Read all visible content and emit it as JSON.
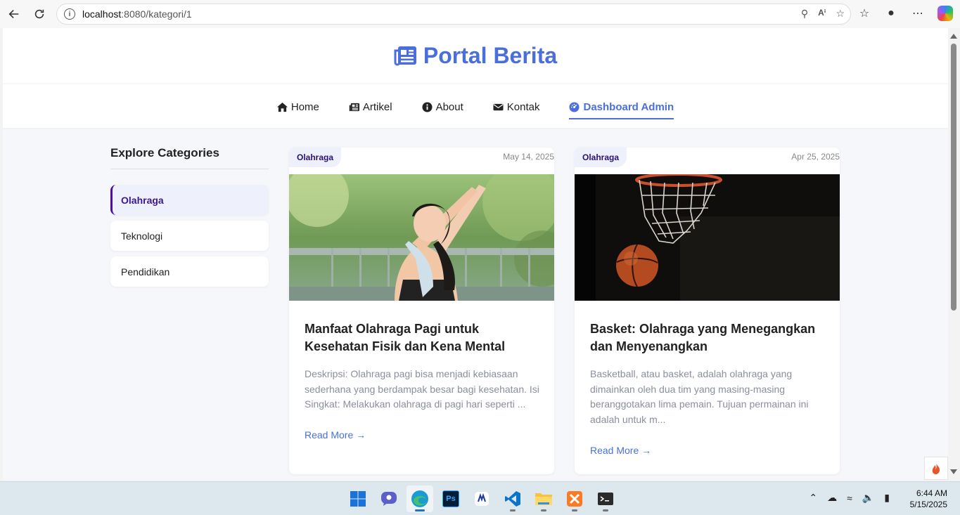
{
  "browser": {
    "url_host": "localhost",
    "url_path": ":8080/kategori/1"
  },
  "site": {
    "brand": "Portal Berita",
    "nav": [
      {
        "label": "Home",
        "icon": "home-icon"
      },
      {
        "label": "Artikel",
        "icon": "newspaper-icon"
      },
      {
        "label": "About",
        "icon": "info-icon"
      },
      {
        "label": "Kontak",
        "icon": "envelope-icon"
      },
      {
        "label": "Dashboard Admin",
        "icon": "dashboard-icon",
        "active": true
      }
    ],
    "accent_color": "#4a6fdc"
  },
  "sidebar": {
    "title": "Explore Categories",
    "items": [
      {
        "label": "Olahraga",
        "active": true
      },
      {
        "label": "Teknologi"
      },
      {
        "label": "Pendidikan"
      }
    ]
  },
  "articles": [
    {
      "category": "Olahraga",
      "date": "May 14, 2025",
      "title": "Manfaat Olahraga Pagi untuk Kesehatan Fisik dan Kena Mental",
      "excerpt": "Deskripsi: Olahraga pagi bisa menjadi kebiasaan sederhana yang berdampak besar bagi kesehatan. Isi Singkat: Melakukan olahraga di pagi hari seperti ...",
      "read_more": "Read More →"
    },
    {
      "category": "Olahraga",
      "date": "Apr 25, 2025",
      "title": "Basket: Olahraga yang Menegangkan dan Menyenangkan",
      "excerpt": "Basketball, atau basket, adalah olahraga yang dimainkan oleh dua tim yang masing-masing beranggotakan lima pemain. Tujuan permainan ini adalah untuk m...",
      "read_more": "Read More →"
    }
  ],
  "taskbar": {
    "time": "6:44 AM",
    "date": "5/15/2025"
  }
}
